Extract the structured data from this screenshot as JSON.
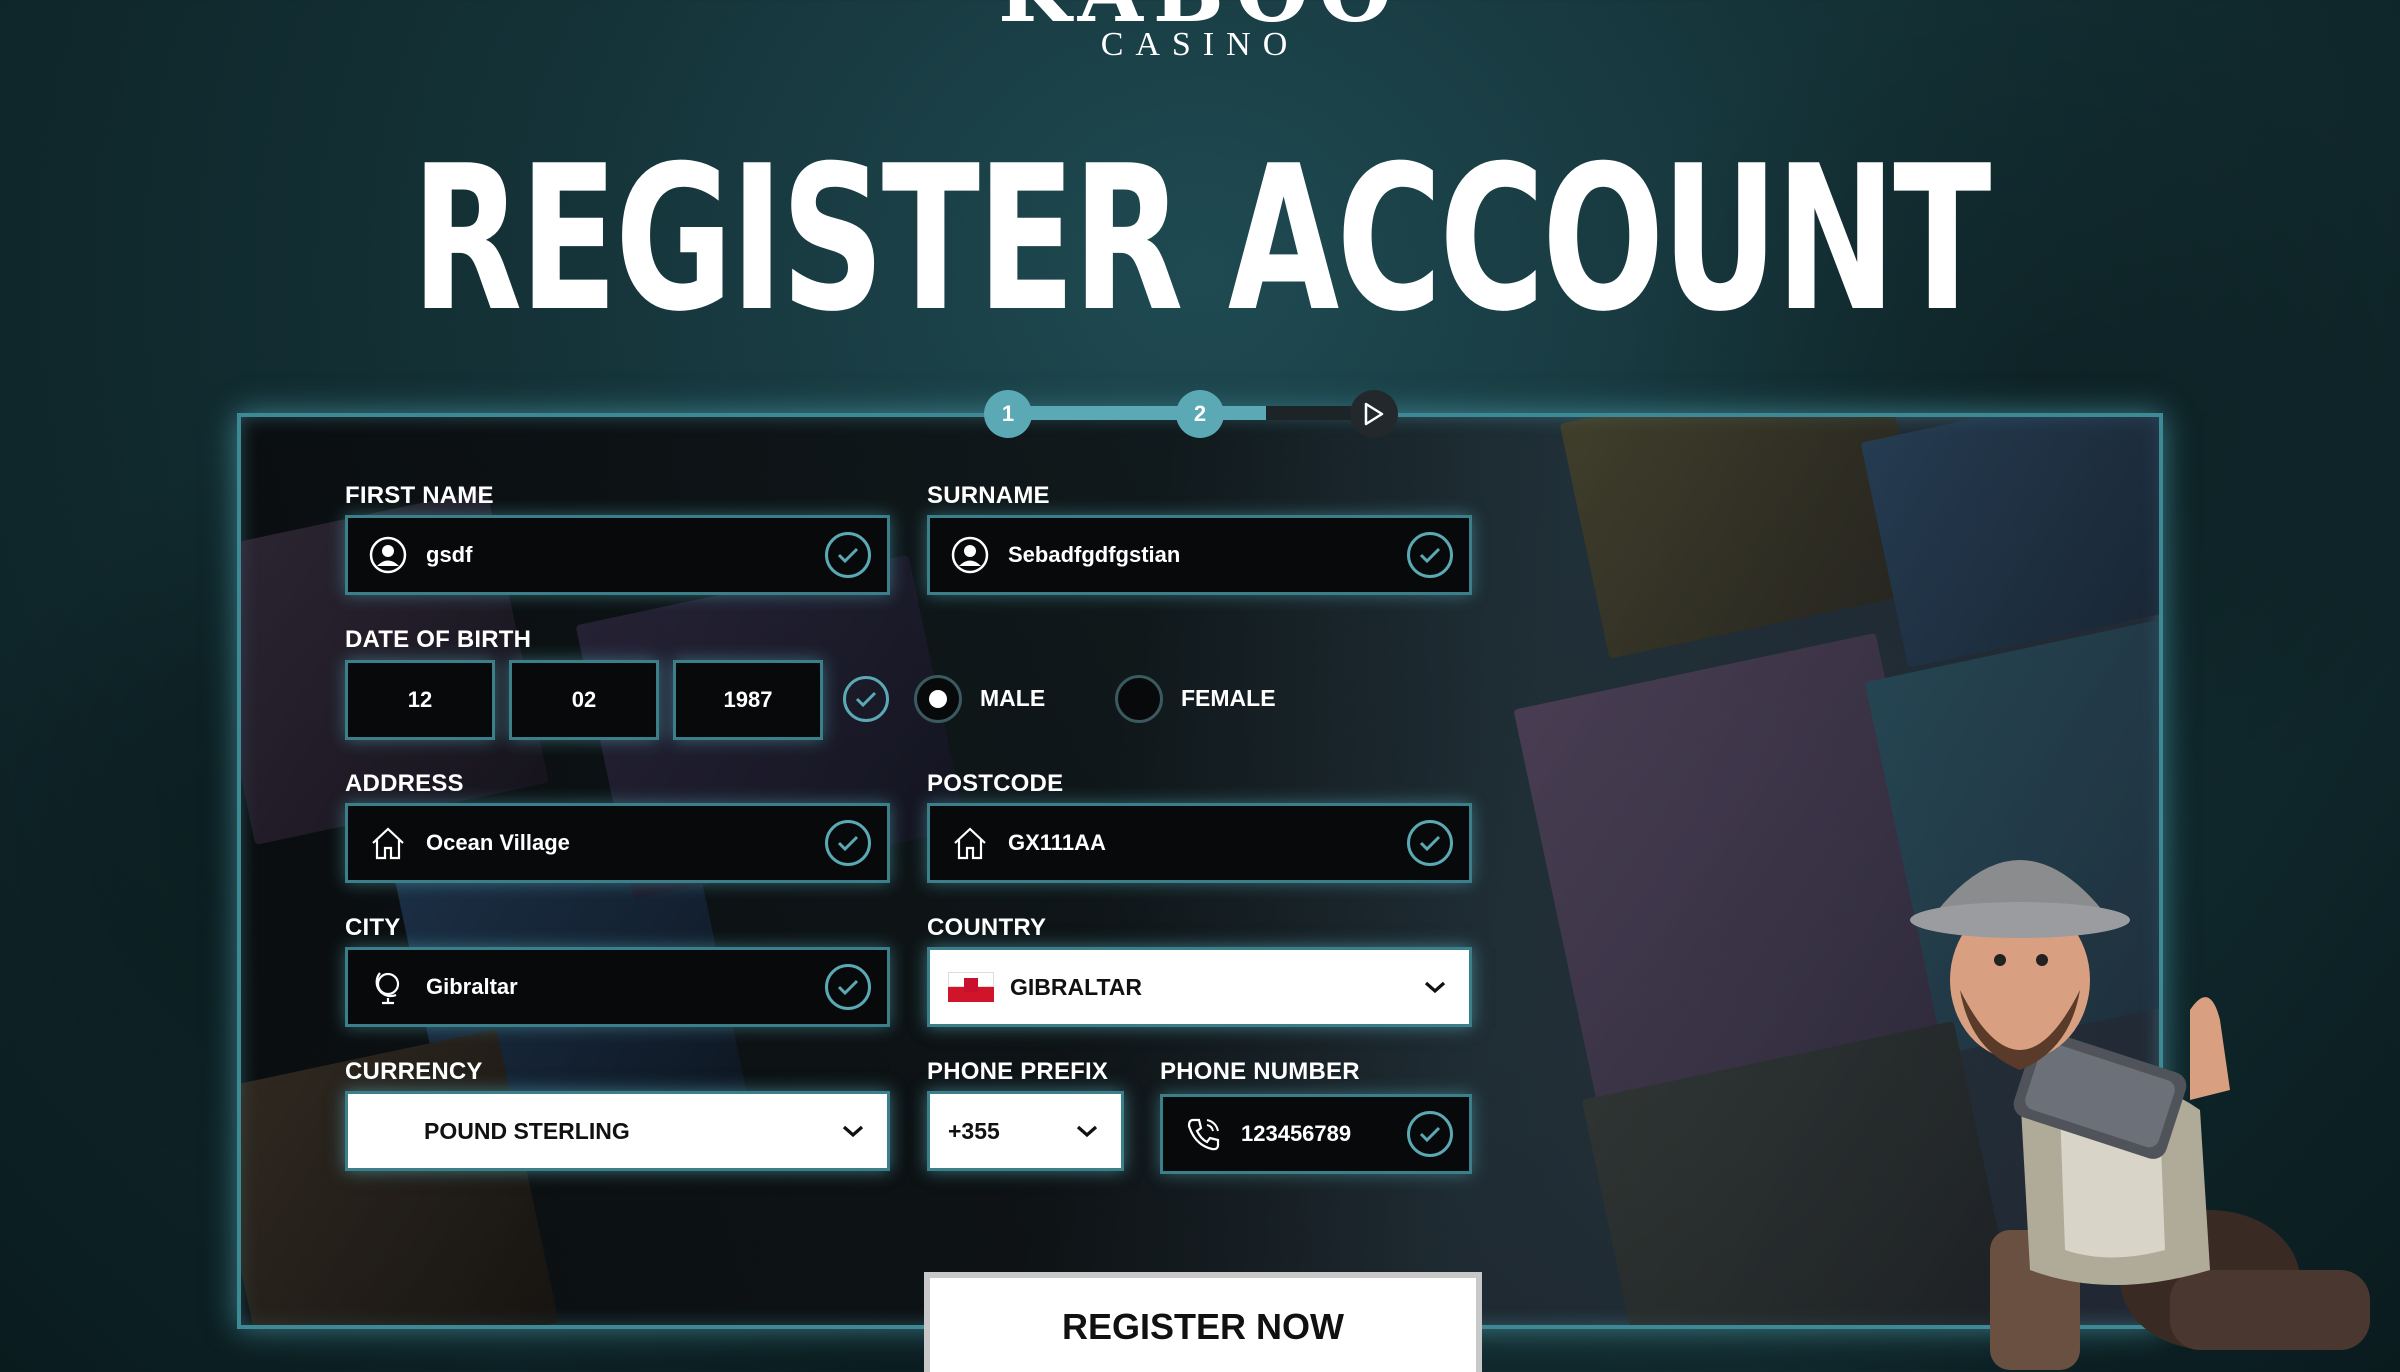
{
  "logo": {
    "main": "KABOO",
    "sub": "CASINO"
  },
  "title": "REGISTER ACCOUNT",
  "stepper": {
    "steps": [
      "1",
      "2"
    ],
    "progress": 0.7
  },
  "form": {
    "first_name": {
      "label": "FIRST NAME",
      "value": "gsdf"
    },
    "surname": {
      "label": "SURNAME",
      "value": "Sebadfgdfgstian"
    },
    "dob": {
      "label": "DATE OF BIRTH",
      "day": "12",
      "month": "02",
      "year": "1987"
    },
    "gender": {
      "male": "MALE",
      "female": "FEMALE",
      "selected": "MALE"
    },
    "address": {
      "label": "ADDRESS",
      "value": "Ocean Village"
    },
    "postcode": {
      "label": "POSTCODE",
      "value": "GX111AA"
    },
    "city": {
      "label": "CITY",
      "value": "Gibraltar"
    },
    "country": {
      "label": "COUNTRY",
      "value": "GIBRALTAR"
    },
    "currency": {
      "label": "CURRENCY",
      "value": "POUND STERLING"
    },
    "phone_prefix": {
      "label": "PHONE PREFIX",
      "value": "+355"
    },
    "phone_number": {
      "label": "PHONE NUMBER",
      "value": "123456789"
    }
  },
  "register_button": "REGISTER NOW",
  "colors": {
    "accent": "#5ba9b4",
    "border": "#3a7f89",
    "background": "#143237"
  }
}
